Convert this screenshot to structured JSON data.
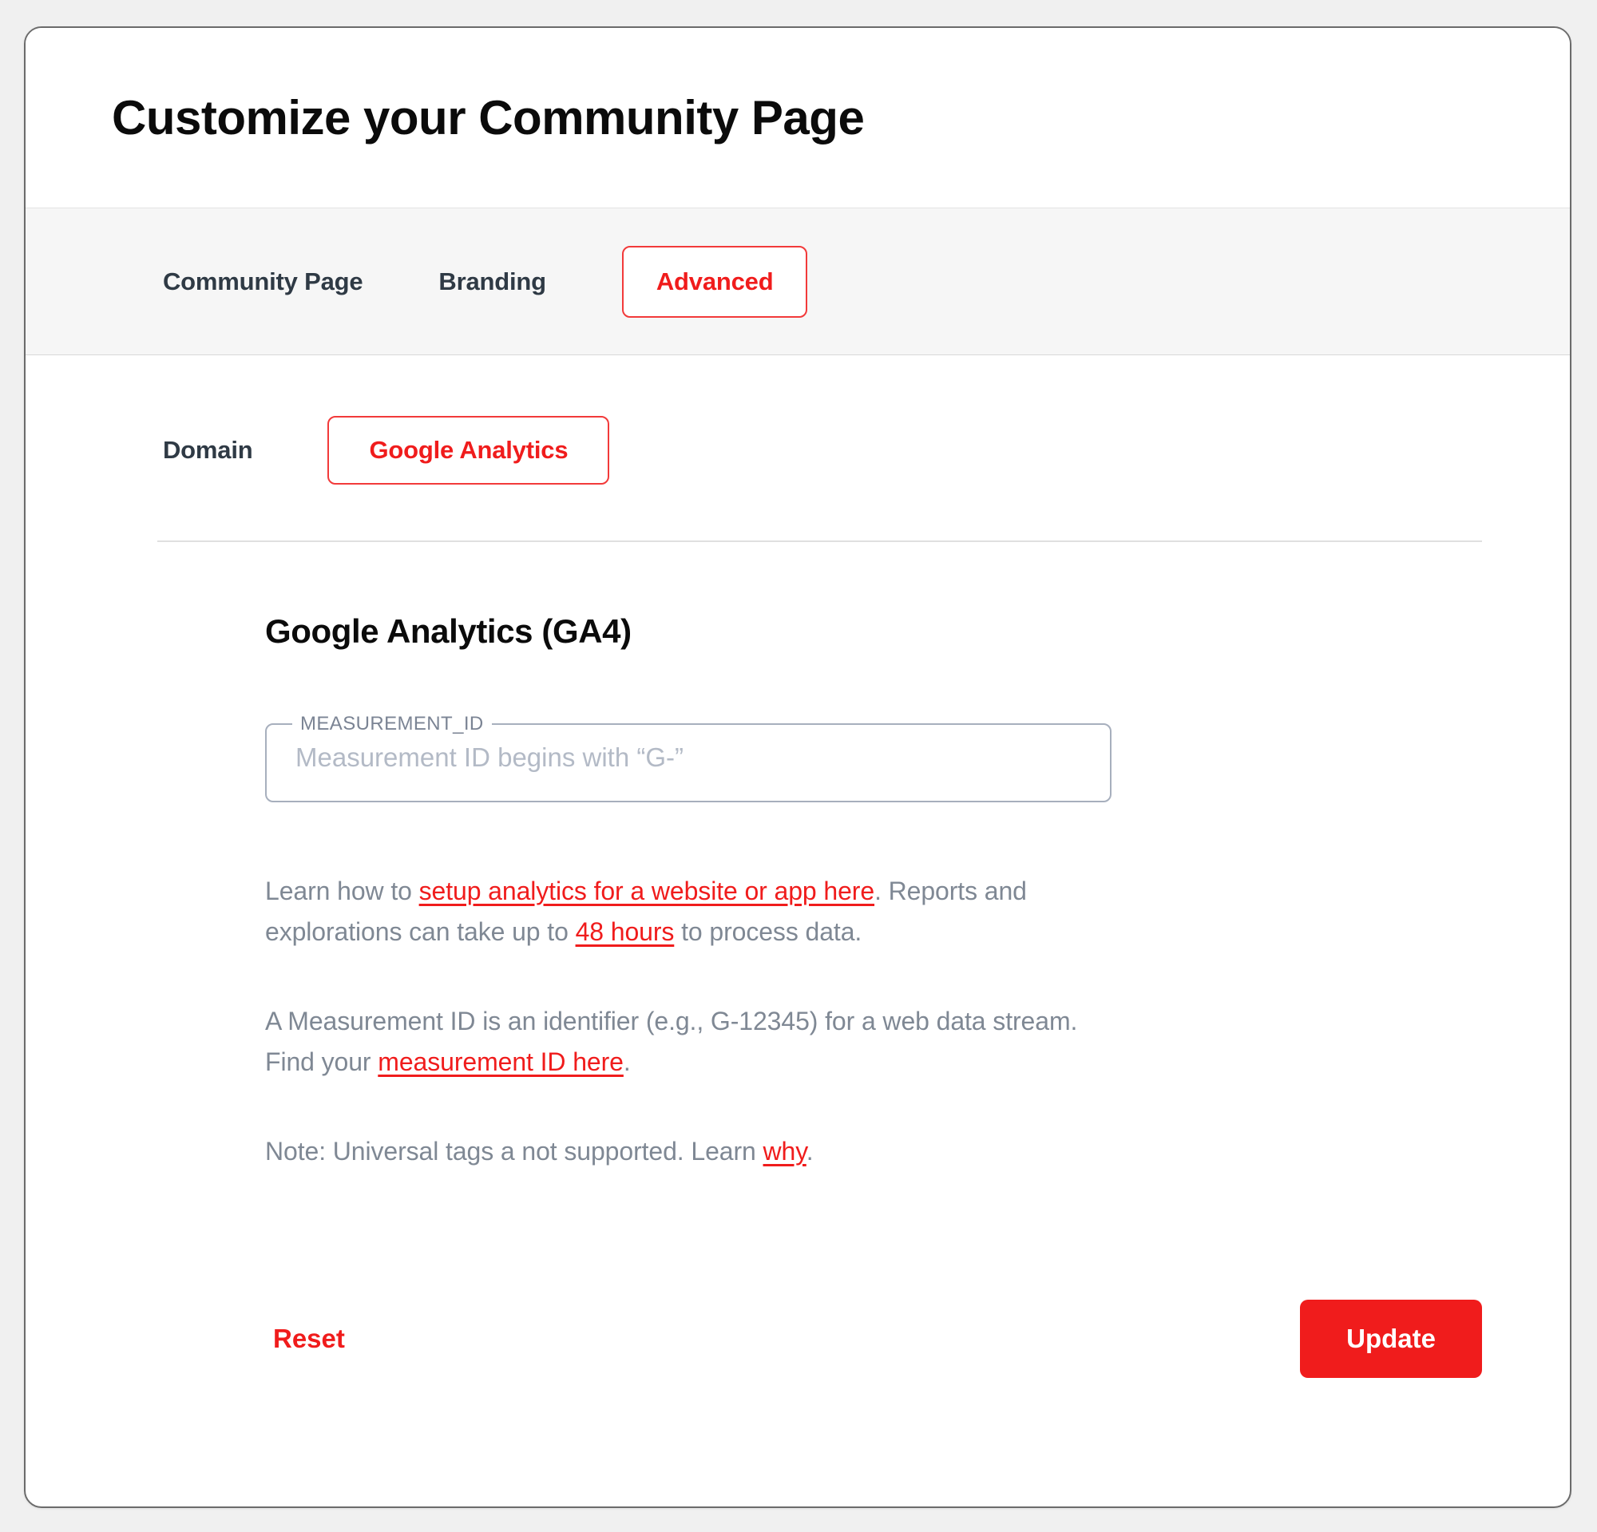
{
  "header": {
    "title": "Customize your Community Page"
  },
  "tabs": [
    {
      "label": "Community Page",
      "active": false
    },
    {
      "label": "Branding",
      "active": false
    },
    {
      "label": "Advanced",
      "active": true
    }
  ],
  "subtabs": [
    {
      "label": "Domain",
      "active": false
    },
    {
      "label": "Google Analytics",
      "active": true
    }
  ],
  "section": {
    "title": "Google Analytics (GA4)",
    "field": {
      "legend": "MEASUREMENT_ID",
      "placeholder": "Measurement ID begins with “G-”",
      "value": ""
    },
    "paragraphs": {
      "p1_a": "Learn how to ",
      "p1_link1": "setup analytics for a website or app here",
      "p1_b": ". Reports and explorations can take up to ",
      "p1_link2": "48 hours",
      "p1_c": " to process data.",
      "p2_a": "A Measurement ID is an identifier (e.g., G-12345) for a web data stream. Find your ",
      "p2_link1": "measurement ID here",
      "p2_b": ".",
      "p3_a": "Note: Universal tags a not supported. Learn ",
      "p3_link1": "why",
      "p3_b": "."
    }
  },
  "actions": {
    "reset_label": "Reset",
    "update_label": "Update"
  },
  "colors": {
    "accent_red": "#f01c1c",
    "text_dark": "#0b0b0b",
    "text_muted": "#7f8894",
    "tabbar_bg": "#f6f6f6",
    "page_bg": "#f0f0f0"
  }
}
